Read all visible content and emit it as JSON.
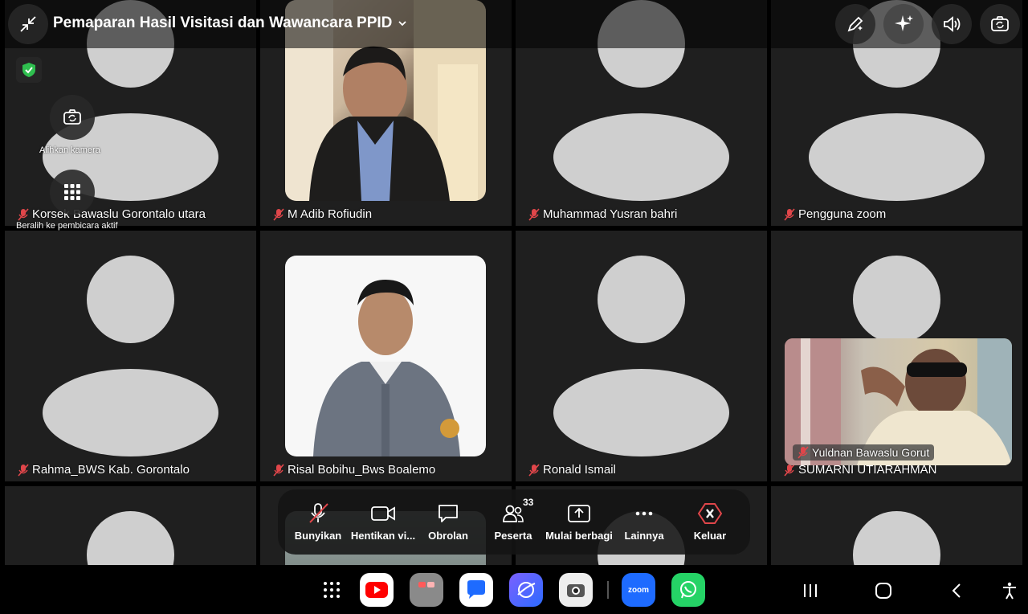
{
  "meeting": {
    "title": "Pemaparan Hasil Visitasi dan Wawancara PPID"
  },
  "overlay": {
    "switch_camera_label": "Alihkan kamera",
    "active_speaker_label": "Beralih ke pembicara aktif"
  },
  "participants": [
    {
      "name": "Korsek Bawaslu Gorontalo utara",
      "muted": true
    },
    {
      "name": "M Adib Rofiudin",
      "muted": true
    },
    {
      "name": "Muhammad Yusran bahri",
      "muted": true
    },
    {
      "name": "Pengguna zoom",
      "muted": true
    },
    {
      "name": "Rahma_BWS Kab. Gorontalo",
      "muted": true
    },
    {
      "name": "Risal Bobihu_Bws Boalemo",
      "muted": true
    },
    {
      "name": "Ronald Ismail",
      "muted": true
    },
    {
      "name": "SUMARNI UTIARAHMAN",
      "muted": true
    }
  ],
  "self_view": {
    "name": "Yuldnan Bawaslu Gorut",
    "muted": true
  },
  "toolbar": {
    "unmute": "Bunyikan",
    "stop_video": "Hentikan vi...",
    "chat": "Obrolan",
    "participants": "Peserta",
    "participants_count": "33",
    "share": "Mulai berbagi",
    "more": "Lainnya",
    "leave": "Keluar"
  },
  "colors": {
    "leave_red": "#e0464a",
    "mute_red": "#e0464a",
    "secure_green": "#2fbf4f",
    "tile_bg": "#1f1f1f",
    "avatar_gray": "#cfcfcf"
  },
  "navbar": {
    "apps": [
      "apps-grid-icon",
      "youtube-icon",
      "gallery-icon",
      "messages-icon",
      "browser-icon",
      "camera-app-icon",
      "zoom-app-icon",
      "whatsapp-icon"
    ],
    "zoom_label": "zoom"
  }
}
